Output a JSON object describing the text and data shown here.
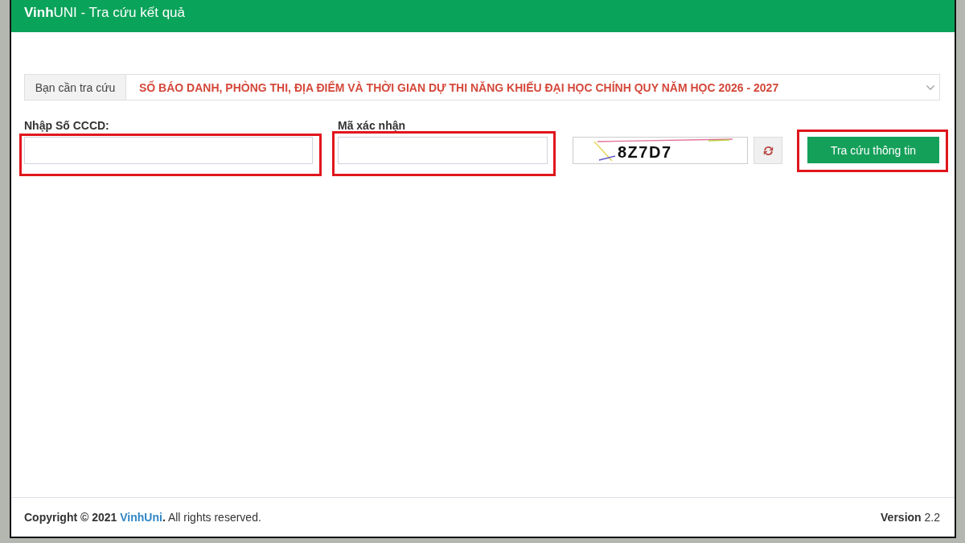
{
  "header": {
    "title": "**Vinh**UNI - Tra cứu kết quả"
  },
  "lookup": {
    "label": "Bạn cần tra cứu",
    "value": "SỐ BÁO DANH, PHÒNG THI, ĐỊA ĐIỂM VÀ THỜI GIAN DỰ THI NĂNG KHIẾU ĐẠI HỌC CHÍNH QUY NĂM HỌC 2026 - 2027"
  },
  "fields": [
    {
      "label": "Nhập Số CCCD:",
      "highlighted": true
    },
    {
      "label": "Mã xác nhận",
      "highlighted": true
    }
  ],
  "captcha": {
    "text": "8Z7D7"
  },
  "submit_button": {
    "label": "Tra cứu thông tin",
    "highlighted": true
  },
  "footer": {
    "copyright": "Copyright © 2021",
    "link": "VinhUni",
    "rest": "**.** All rights reserved.",
    "version": "**Version** 2.2"
  }
}
